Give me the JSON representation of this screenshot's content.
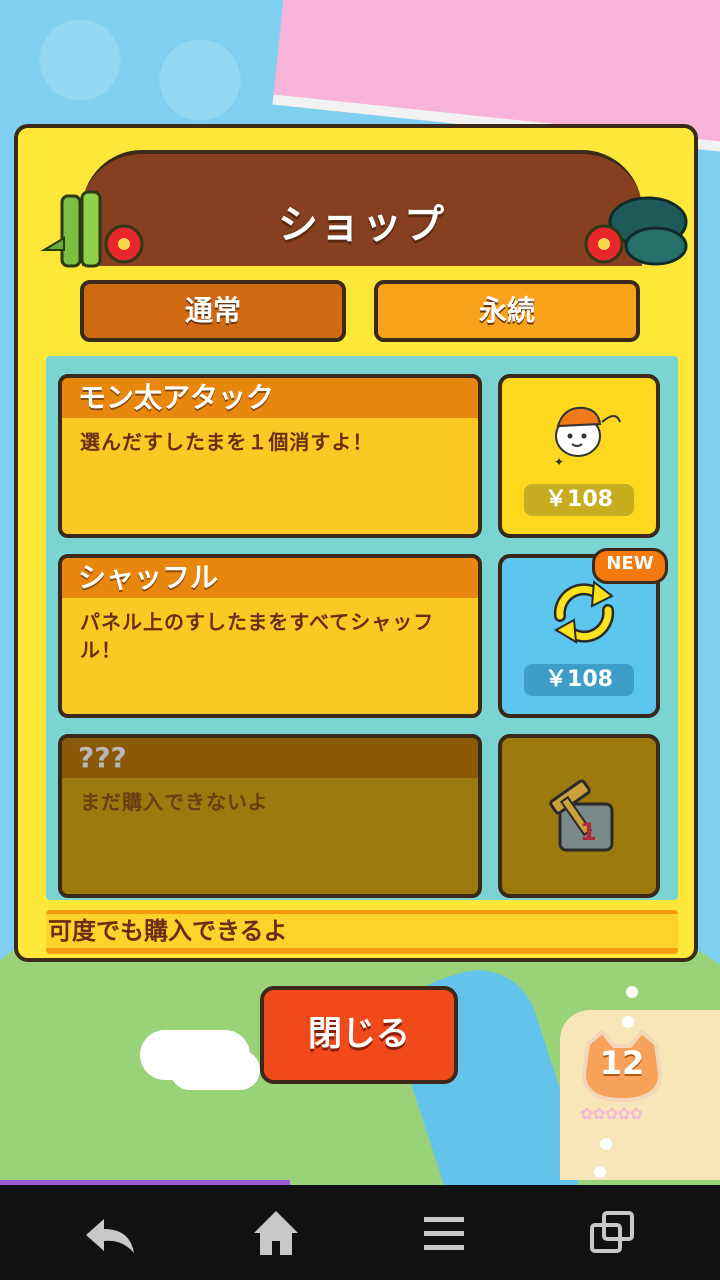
{
  "dialog": {
    "title": "ショップ",
    "tabs": {
      "normal": "通常",
      "permanent": "永続"
    },
    "items": [
      {
        "name": "モン太アタック",
        "description": "選んだすしたまを１個消すよ！",
        "price": "￥108",
        "state": "available",
        "icon": "monta-character-icon"
      },
      {
        "name": "シャッフル",
        "description": "パネル上のすしたまをすべてシャッフル！",
        "price": "￥108",
        "state": "available",
        "badge": "NEW",
        "icon": "shuffle-arrows-icon"
      },
      {
        "name": "???",
        "description": "まだ購入できないよ",
        "state": "locked",
        "icon": "locked-hammer-icon"
      }
    ],
    "footer_message": "可度でも購入できるよ",
    "close_label": "閉じる"
  },
  "hud": {
    "level": "12",
    "stars_filled": 5
  },
  "colors": {
    "dialog_bg": "#fde83a",
    "banner": "#86401f",
    "tab_active": "#cf6a12",
    "tab_inactive": "#f7a21a",
    "close": "#f04a1c"
  }
}
